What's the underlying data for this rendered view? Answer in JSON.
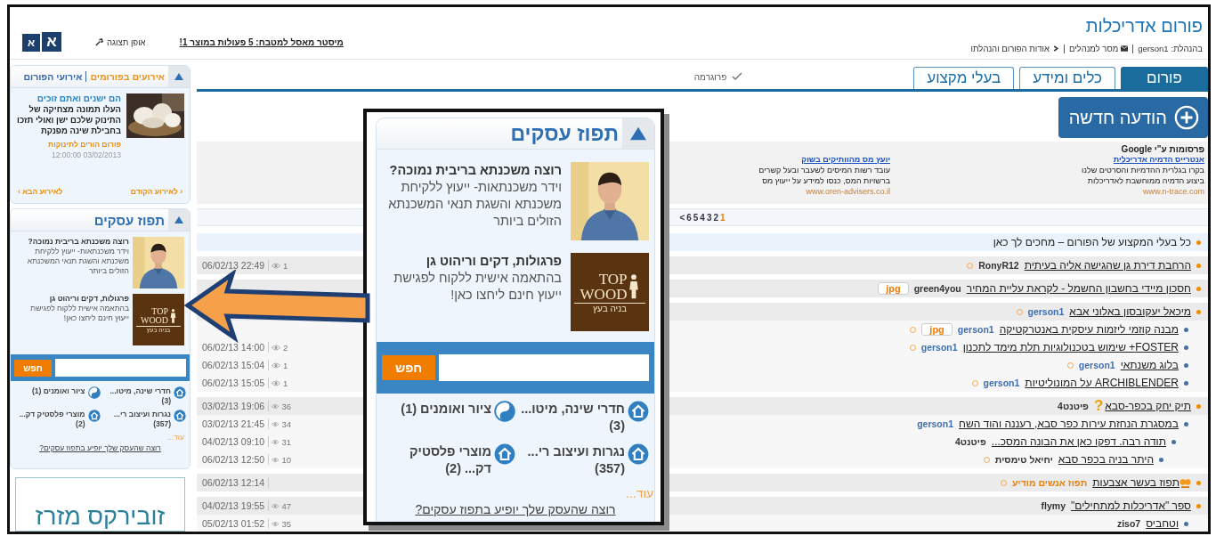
{
  "header": {
    "title": "פורום אדריכלות",
    "managers_label": "בהנהלת:",
    "manager": "gerson1",
    "links": [
      "מסר למנהלים",
      "אודות הפורום והנהלתו"
    ],
    "promo_link": "מיסטר מאסל למטבח: 5 פעולות במוצר 1!",
    "view_mode": "אופן תצוגה",
    "font_buttons": [
      "א",
      "א"
    ]
  },
  "tabs": [
    {
      "label": "פורום",
      "selected": true
    },
    {
      "label": "כלים ומידע",
      "selected": false
    },
    {
      "label": "בעלי מקצוע",
      "selected": false
    }
  ],
  "program_link": "פרוגרמה",
  "new_post_button": "הודעה חדשה",
  "ads": {
    "label": "פרסומות ע\"י Google",
    "items": [
      {
        "title": "אנטרייס הדמיה אדריכלית",
        "lines": [
          "בקרו בגלרית ההדמיות והסרטים שלנו",
          "ביצוע הדמיה ממוחשבת לאדריכלות"
        ],
        "url": "www.n-trace.com"
      },
      {
        "title": "יועץ מס מהוותיקים בשוק",
        "lines": [
          "עובד רשות המיסים לשעבר ובעל קשרים",
          "ברשויות המס, כנסו למידע על ייעוץ מס"
        ],
        "url": "www.oren-advisers.co.il"
      }
    ]
  },
  "pagination": {
    "pages": [
      {
        "label": "1",
        "selected": true
      },
      {
        "label": "2",
        "selected": false
      },
      {
        "label": "3",
        "selected": false
      },
      {
        "label": "4",
        "selected": false
      },
      {
        "label": "5",
        "selected": false
      },
      {
        "label": "6",
        "selected": false
      }
    ],
    "next": "<"
  },
  "threads": [
    {
      "kind": "sticky",
      "title": "כל בעלי המקצוע של הפורום – מחכים לך כאן",
      "unread": false
    },
    {
      "kind": "topic",
      "title": "הרחבת דירת גן שהגישה אליה בעיתית",
      "author": "RonyR12",
      "is_manager": false,
      "unread": true,
      "date": "06/02/13 22:49",
      "views": "1"
    },
    {
      "kind": "topic",
      "title": "חסכון מיידי בחשבון החשמל - לקראת עליית המחיר",
      "author": "green4you",
      "is_manager": false,
      "attachment": "jpg",
      "unread": false
    },
    {
      "kind": "topic",
      "title": "מיכאל יעקובסון באלוני אבא",
      "author": "gerson1",
      "is_manager": true,
      "unread": true,
      "children": [
        {
          "kind": "topic",
          "title": "מבנה קוזמי ליזמות עיסקית באנטרקטיקה",
          "author": "gerson1",
          "is_manager": true,
          "attachment": "jpg",
          "unread": true
        },
        {
          "kind": "topic",
          "title": "FOSTER+ שימוש בטכנולוגיות תלת מימד לתכנון",
          "author": "gerson1",
          "is_manager": true,
          "unread": true,
          "date": "06/02/13 14:00",
          "views": "2"
        },
        {
          "kind": "topic",
          "title": "בלוג משנתאי",
          "author": "gerson1",
          "is_manager": true,
          "unread": true,
          "date": "06/02/13 15:04",
          "views": "1"
        },
        {
          "kind": "topic",
          "title": "ARCHIBLENDER על המונוליטיות",
          "author": "gerson1",
          "is_manager": true,
          "unread": true,
          "date": "06/02/13 15:05",
          "views": "1"
        }
      ]
    },
    {
      "kind": "topic",
      "title": "תיק יחק בכפר-סבא",
      "mark": "?",
      "author": "פיטנט4",
      "is_manager": false,
      "unread": false,
      "date": "03/02/13 19:06",
      "views": "36",
      "children": [
        {
          "kind": "topic",
          "title": "במסגרת הנחזת עירות כפר סבא, רעננה והוד השח",
          "author": "gerson1",
          "is_manager": true,
          "unread": false,
          "date": "03/02/13 21:45",
          "views": "34",
          "children": [
            {
              "kind": "topic",
              "title": "תודה רבה. דפקו כאן את הבונה המסכ...",
              "author": "פיטנט4",
              "is_manager": false,
              "unread": false,
              "date": "04/02/13 09:10",
              "views": "31",
              "children": [
                {
                  "kind": "topic",
                  "title": "היתר בניה בכפר סבא",
                  "author": "יחיאל טימסית",
                  "is_manager": false,
                  "unread": true,
                  "date": "06/02/13 12:50",
                  "views": "10"
                }
              ]
            }
          ]
        }
      ]
    },
    {
      "kind": "promo",
      "title": "תפוז בעשר אצבעות",
      "author": "תפוז אנשים מודיע",
      "unread": true,
      "date": "06/02/13 12:14"
    },
    {
      "kind": "topic",
      "title": "ספר \"אדריכלות למתחילים\"",
      "author": "flymy",
      "is_manager": false,
      "unread": false,
      "date": "04/02/13 19:55",
      "views": "47",
      "children": [
        {
          "kind": "topic",
          "title": "וטחביס",
          "author": "ziso7",
          "is_manager": false,
          "unread": false,
          "date": "05/02/13 01:52",
          "views": "35"
        }
      ]
    }
  ],
  "sidebar": {
    "events": {
      "tabs": [
        {
          "label": "אירועים בפורומים",
          "selected": true
        },
        {
          "label": "אירועי הפורום",
          "selected": false
        }
      ],
      "title": "הם ישנים ואתם זוכים",
      "text": "העלו תמונה מצחיקה של התינוק שלכם ישן ואולי תזכו בחבילת שינה מפנקת",
      "forum": "פורום הורים לתינוקות",
      "date": "12:00:00 03/02/2013",
      "prev": "‹ לאירוע הקודם",
      "next": "לאירוע הבא ›"
    },
    "business": {
      "title": "תפוז עסקים",
      "items": [
        {
          "kind": "person",
          "headline": "רוצה משכנתא בריבית נמוכה?",
          "text": "וידר משכנתאות- ייעוץ ללקיחת משכנתא והשגת תנאי המשכנתא הזולים ביותר"
        },
        {
          "kind": "logo",
          "logo": [
            "TOP",
            "WOOD",
            "בניה בעץ"
          ],
          "headline": "פרגולות, דקים וריהוט גן",
          "text": "בהתאמה אישית ללקוח לפגישת ייעוץ חינם ליחצו כאן!"
        }
      ],
      "search_button": "חפש",
      "categories": [
        "חדרי שינה, מיטו... (3)",
        "ציור ואומנים (1)",
        "נגרות ועיצוב רי... (357)",
        "מוצרי פלסטיק דק... (2)"
      ],
      "more": "עוד...",
      "join_link": "רוצה שהעסק שלך יופיע בתפוז עסקים?"
    },
    "ad": {
      "text": "זובירקס מזרז"
    }
  },
  "callout": {
    "business": {
      "title": "תפוז עסקים",
      "items": [
        {
          "kind": "person",
          "headline": "רוצה משכנתא בריבית נמוכה?",
          "text": "וידר משכנתאות- ייעוץ ללקיחת משכנתא והשגת תנאי המשכנתא הזולים ביותר"
        },
        {
          "kind": "logo",
          "logo": [
            "TOP",
            "WOOD",
            "בניה בעץ"
          ],
          "headline": "פרגולות, דקים וריהוט גן",
          "text": "בהתאמה אישית ללקוח לפגישת ייעוץ חינם ליחצו כאן!"
        }
      ],
      "search_button": "חפש",
      "categories": [
        "חדרי שינה, מיטו... (3)",
        "ציור ואומנים (1)",
        "נגרות ועיצוב רי... (357)",
        "מוצרי פלסטיק דק... (2)"
      ],
      "more": "עוד...",
      "join_link": "רוצה שהעסק שלך יופיע בתפוז עסקים?"
    }
  }
}
